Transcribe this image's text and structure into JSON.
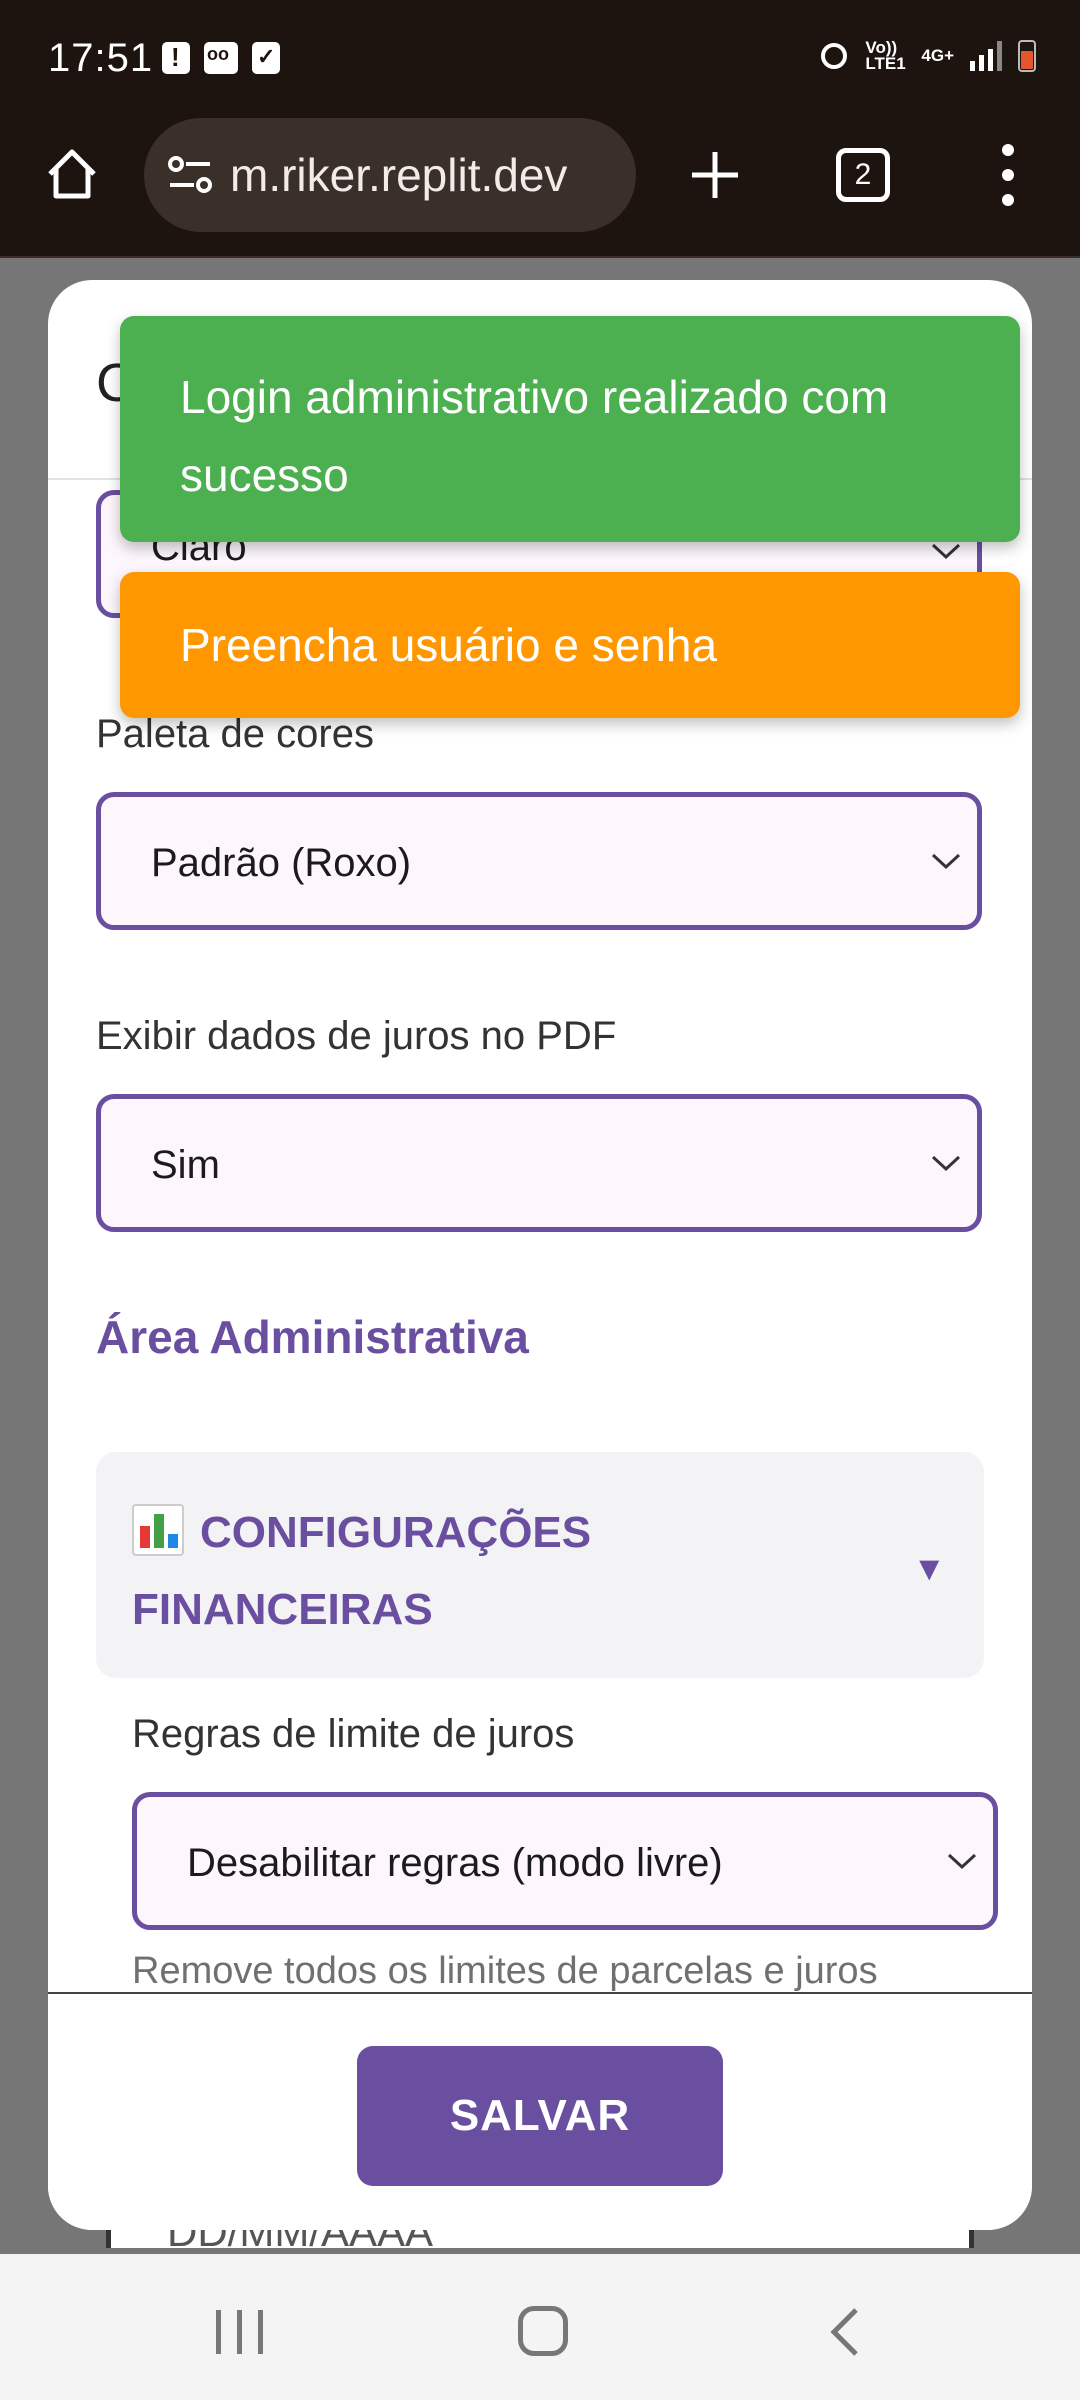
{
  "status_bar": {
    "time": "17:51",
    "left_icons": [
      "alert-icon",
      "voicemail-icon",
      "checkbox-icon"
    ],
    "right_icons": [
      "recycle-icon",
      "volte-icon",
      "network-4g-icon",
      "signal-icon",
      "battery-icon"
    ],
    "volte_label": "Vo)) LTE1",
    "network_label": "4G+"
  },
  "browser": {
    "url": "m.riker.replit.dev",
    "tab_count": "2"
  },
  "modal": {
    "title_partial": "C",
    "theme_value": "Claro",
    "palette_label": "Paleta de cores",
    "palette_value": "Padrão (Roxo)",
    "interest_pdf_label": "Exibir dados de juros no PDF",
    "interest_pdf_value": "Sim",
    "admin_section_title": "Área Administrativa",
    "accordion_title": "CONFIGURAÇÕES FINANCEIRAS",
    "accordion_caret": "▼",
    "rules_label": "Regras de limite de juros",
    "rules_value": "Desabilitar regras (modo livre)",
    "rules_hint": "Remove todos os limites de parcelas e juros",
    "save_label": "SALVAR"
  },
  "background": {
    "date_placeholder": "DD/MM/AAAA"
  },
  "toasts": [
    {
      "type": "success",
      "message": "Login administrativo realizado com sucesso",
      "color": "#4caf50"
    },
    {
      "type": "warning",
      "message": "Preencha usuário e senha",
      "color": "#ff9800"
    }
  ],
  "colors": {
    "accent": "#6a4fa0",
    "browser_chrome": "#1d130f",
    "select_bg": "#fdf7fd"
  }
}
